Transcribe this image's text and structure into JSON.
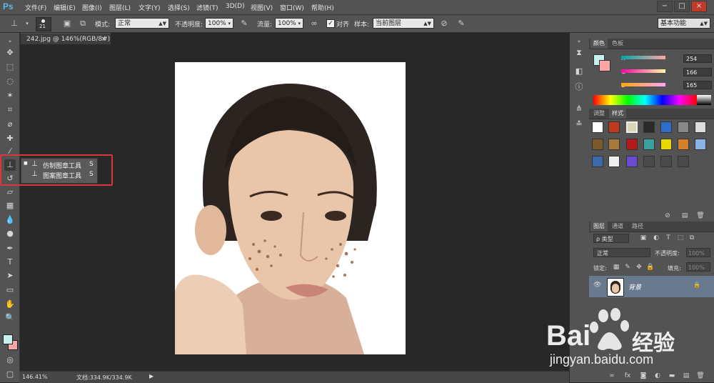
{
  "app": {
    "logo": "Ps"
  },
  "menu": [
    "文件(F)",
    "编辑(E)",
    "图像(I)",
    "图层(L)",
    "文字(Y)",
    "选择(S)",
    "滤镜(T)",
    "3D(D)",
    "视图(V)",
    "窗口(W)",
    "帮助(H)"
  ],
  "window_controls": [
    "−",
    "□",
    "×"
  ],
  "options": {
    "brush_size": "21",
    "mode_label": "模式:",
    "mode_value": "正常",
    "opacity_label": "不透明度:",
    "opacity_value": "100%",
    "flow_label": "流量:",
    "flow_value": "100%",
    "align_label": "对齐",
    "align_checked": "✓",
    "sample_label": "样本:",
    "sample_value": "当前图层",
    "workspace_value": "基本功能"
  },
  "document": {
    "tab_title": "242.jpg @ 146%(RGB/8#)",
    "tab_close": "×",
    "zoom": "146.41%",
    "doc_info": "文档:334.9K/334.9K"
  },
  "flyout": {
    "items": [
      {
        "label": "仿制图章工具",
        "shortcut": "S",
        "selected": "■"
      },
      {
        "label": "图案图章工具",
        "shortcut": "S",
        "selected": ""
      }
    ]
  },
  "color_panel": {
    "tabs": [
      "颜色",
      "色板"
    ],
    "channels": [
      {
        "name": "R",
        "value": "254"
      },
      {
        "name": "G",
        "value": "166"
      },
      {
        "name": "B",
        "value": "165"
      }
    ],
    "foreground": "#c6f1ef",
    "background": "#fea6a5"
  },
  "styles_panel": {
    "tabs": [
      "调整",
      "样式"
    ]
  },
  "layers_panel": {
    "tabs": [
      "图层",
      "通道",
      "路径"
    ],
    "filter_label": "类型",
    "blend_value": "正常",
    "opacity_label": "不透明度:",
    "opacity_value": "100%",
    "lock_label": "锁定:",
    "fill_label": "填充:",
    "fill_value": "100%",
    "layers": [
      {
        "name": "背景",
        "visible": "👁",
        "locked": "🔒"
      }
    ]
  },
  "watermark": {
    "brand": "Bai",
    "brand_suffix": "经验",
    "url": "jingyan.baidu.com"
  },
  "icons": {
    "stamp": "stamp-icon",
    "pattern_stamp": "pattern-stamp-icon"
  }
}
